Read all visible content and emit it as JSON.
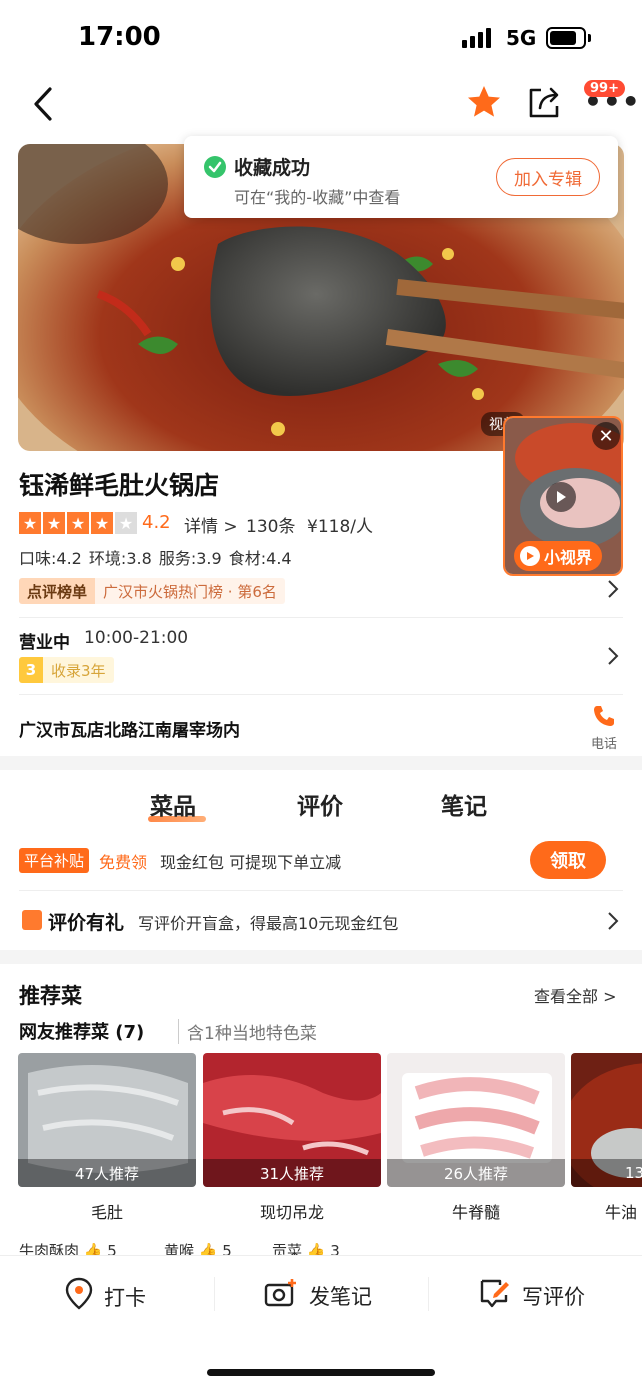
{
  "status_bar": {
    "time": "17:00",
    "network": "5G"
  },
  "nav": {
    "badge": "99+"
  },
  "toast": {
    "title": "收藏成功",
    "subtitle": "可在“我的-收藏”中查看",
    "button": "加入专辑"
  },
  "hero": {
    "tag": "视频",
    "mini_video_label": "小视界"
  },
  "shop": {
    "name": "钰浠鲜毛肚火锅店",
    "rating": "4.2",
    "stars_filled": 4,
    "stars_total": 5,
    "details_label": "详情 >",
    "review_count": "130条",
    "price": "¥118/人",
    "sub_scores": "口味:4.2  环境:3.8  服务:3.9  食材:4.4",
    "rank_badge_label": "点评榜单",
    "rank_text": "广汉市火锅热门榜 · 第6名",
    "open_status": "营业中",
    "hours": "10:00-21:00",
    "years_num": "3",
    "years_text": "收录3年",
    "address": "广汉市瓦店北路江南屠宰场内",
    "phone_label": "电话"
  },
  "tabs": [
    {
      "label": "菜品",
      "active": true
    },
    {
      "label": "评价",
      "active": false
    },
    {
      "label": "笔记",
      "active": false
    }
  ],
  "subsidy": {
    "tag": "平台补贴",
    "free": "免费领",
    "text": "现金红包 可提现下单立减",
    "button": "领取"
  },
  "review_gift": {
    "title": "评价有礼",
    "text": "写评价开盲盒，得最高10元现金红包"
  },
  "recommend": {
    "title": "推荐菜",
    "view_all": "查看全部 >",
    "subtitle": "网友推荐菜 (7)",
    "subtitle_note": "含1种当地特色菜",
    "dishes": [
      {
        "name": "毛肚",
        "rec": "47人推荐"
      },
      {
        "name": "现切吊龙",
        "rec": "31人推荐"
      },
      {
        "name": "牛脊髓",
        "rec": "26人推荐"
      },
      {
        "name": "牛油",
        "rec": "13"
      }
    ],
    "tags": [
      {
        "name": "牛肉酥肉",
        "count": "5"
      },
      {
        "name": "黄喉",
        "count": "5"
      },
      {
        "name": "贡菜",
        "count": "3"
      }
    ]
  },
  "bottom_bar": {
    "checkin": "打卡",
    "note": "发笔记",
    "review": "写评价"
  },
  "colors": {
    "accent": "#ff6a1a",
    "success": "#35c46b"
  }
}
